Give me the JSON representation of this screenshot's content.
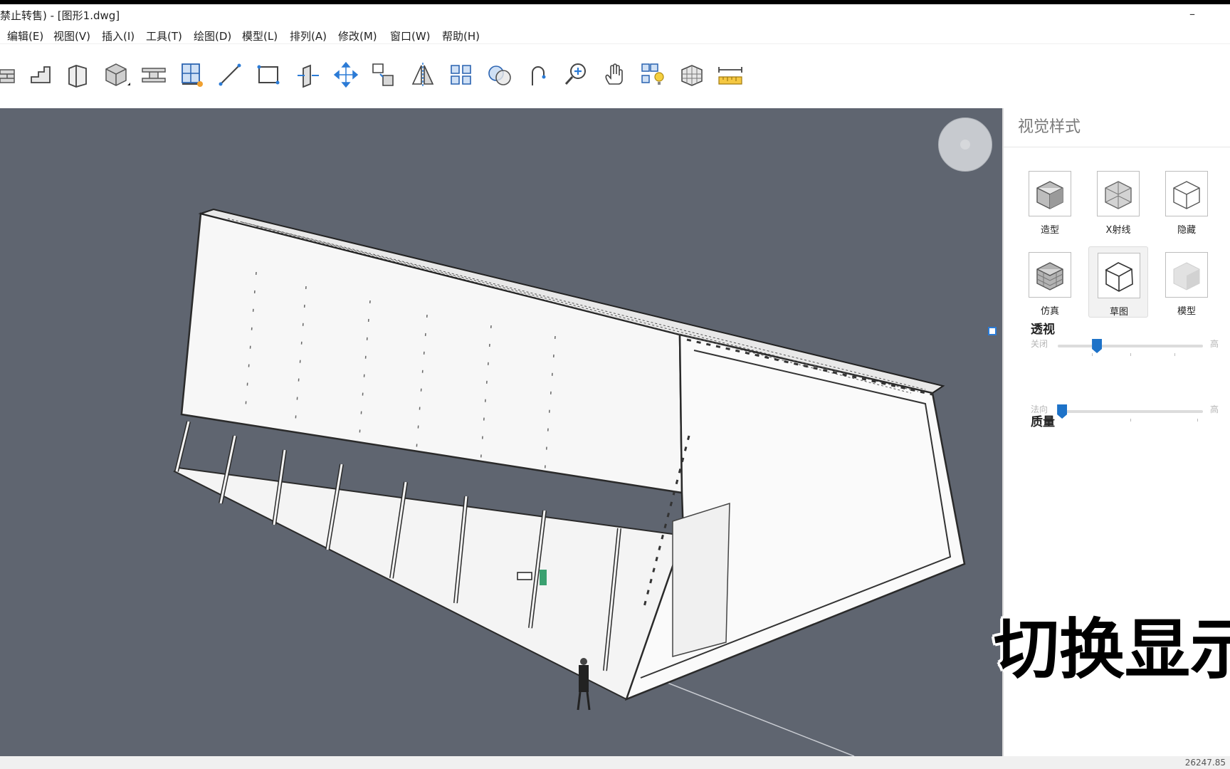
{
  "window": {
    "title": "禁止转售) - [图形1.dwg]",
    "minimize": "–"
  },
  "menu": [
    "编辑(E)",
    "视图(V)",
    "插入(I)",
    "工具(T)",
    "绘图(D)",
    "模型(L)",
    "排列(A)",
    "修改(M)",
    "窗口(W)",
    "帮助(H)"
  ],
  "toolbar": {
    "tools": [
      "wall-tool",
      "stair-tool",
      "column-tool",
      "box-tool",
      "beam-tool",
      "window-tool",
      "line-tool",
      "rectangle-tool",
      "extrude-tool",
      "move-tool",
      "copy-tool",
      "mirror-tool",
      "array-tool",
      "boolean-tool",
      "arc-tool",
      "zoom-tool",
      "pan-tool",
      "light-tool",
      "hatch-tool",
      "measure-tool"
    ]
  },
  "panel": {
    "title": "视觉样式",
    "styles": [
      {
        "label": "造型",
        "icon": "shaded-cube-icon",
        "selected": false
      },
      {
        "label": "X射线",
        "icon": "xray-cube-icon",
        "selected": false
      },
      {
        "label": "隐藏",
        "icon": "hidden-cube-icon",
        "selected": false
      },
      {
        "label": "仿真",
        "icon": "realistic-cube-icon",
        "selected": false
      },
      {
        "label": "草图",
        "icon": "sketch-cube-icon",
        "selected": true
      },
      {
        "label": "模型",
        "icon": "model-cube-icon",
        "selected": false
      }
    ],
    "perspective": {
      "heading": "透视",
      "low": "关闭",
      "high": "高",
      "value": 0.27
    },
    "quality": {
      "heading": "质量",
      "low": "法向",
      "high": "高",
      "value": 0.03
    }
  },
  "overlay_caption": "切换显示",
  "status": {
    "coords": "26247.85"
  },
  "colors": {
    "viewport_bg": "#5f6570",
    "accent": "#1d72c8"
  }
}
